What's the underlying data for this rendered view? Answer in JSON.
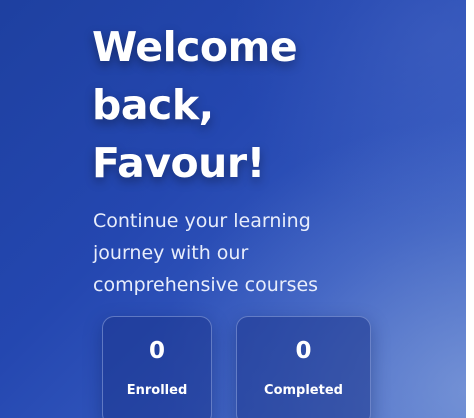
{
  "hero": {
    "headline_lines": [
      "Welcome",
      "back,",
      "Favour!"
    ],
    "subtitle_lines": [
      "Continue your learning",
      "journey with our",
      "comprehensive courses"
    ]
  },
  "stats": [
    {
      "value": "0",
      "label": "Enrolled"
    },
    {
      "value": "0",
      "label": "Completed"
    }
  ],
  "colors": {
    "background_start": "#1e40a0",
    "background_end": "#4a6ec8",
    "card_background": "#1c348c",
    "text": "#ffffff"
  }
}
